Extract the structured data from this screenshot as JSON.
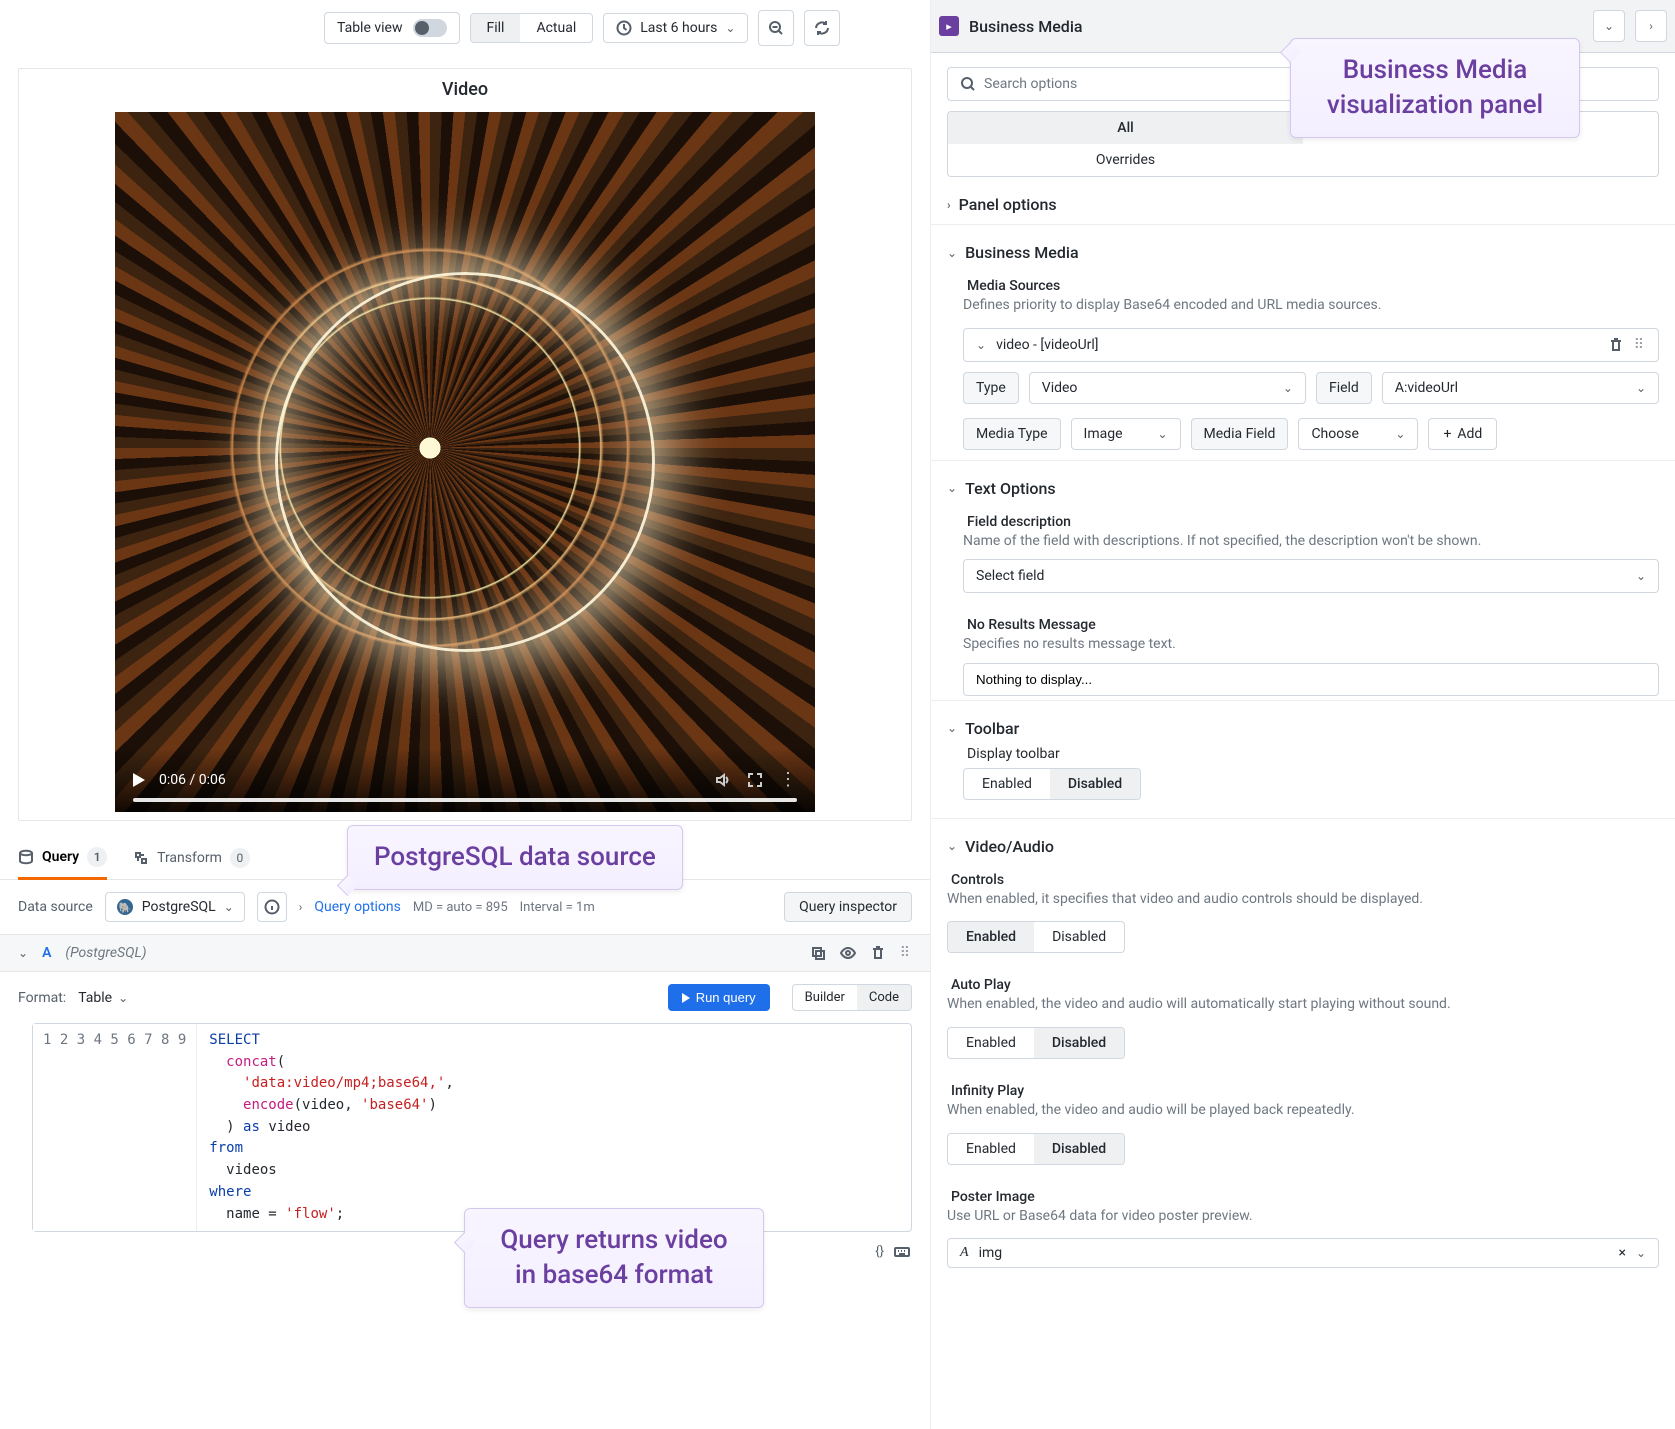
{
  "toolbar": {
    "table_view": "Table view",
    "fill": "Fill",
    "actual": "Actual",
    "time_range": "Last 6 hours"
  },
  "panel": {
    "title": "Video",
    "time_current": "0:06",
    "time_total": "0:06"
  },
  "tabs": {
    "query": "Query",
    "query_badge": "1",
    "transform": "Transform",
    "transform_badge": "0"
  },
  "ds_row": {
    "label": "Data source",
    "selected": "PostgreSQL",
    "query_options": "Query options",
    "md": "MD = auto = 895",
    "interval": "Interval = 1m",
    "inspector": "Query inspector"
  },
  "query": {
    "ref": "A",
    "ds_name": "(PostgreSQL)",
    "format_label": "Format:",
    "format_value": "Table",
    "run": "Run query",
    "builder": "Builder",
    "code": "Code",
    "lines": [
      "1",
      "2",
      "3",
      "4",
      "5",
      "6",
      "7",
      "8",
      "9"
    ],
    "sql": {
      "l1_select": "SELECT",
      "l2_concat": "concat",
      "l3_str": "'data:video/mp4;base64,'",
      "l4_encode": "encode",
      "l4_arg1": "video",
      "l4_str": "'base64'",
      "l5_as": "as",
      "l5_alias": "video",
      "l6_from": "from",
      "l7_table": "videos",
      "l8_where": "where",
      "l9_col": "name",
      "l9_val": "'flow'"
    },
    "footer_brace": "{}"
  },
  "viz": {
    "header_name": "Business Media",
    "search_placeholder": "Search options",
    "tab_all": "All",
    "tab_overrides": "Overrides"
  },
  "sections": {
    "panel_options": "Panel options",
    "business_media": "Business Media",
    "media_sources_title": "Media Sources",
    "media_sources_desc": "Defines priority to display Base64 encoded and URL media sources.",
    "src_item": "video - [videoUrl]",
    "type_label": "Type",
    "type_value": "Video",
    "field_label": "Field",
    "field_value": "A:videoUrl",
    "media_type_label": "Media Type",
    "media_type_value": "Image",
    "media_field_label": "Media Field",
    "media_field_value": "Choose",
    "add_btn": "Add",
    "text_options": "Text Options",
    "field_desc_title": "Field description",
    "field_desc_desc": "Name of the field with descriptions. If not specified, the description won't be shown.",
    "field_desc_select": "Select field",
    "nores_title": "No Results Message",
    "nores_desc": "Specifies no results message text.",
    "nores_value": "Nothing to display...",
    "toolbar_title": "Toolbar",
    "toolbar_sub": "Display toolbar",
    "enabled": "Enabled",
    "disabled": "Disabled",
    "video_audio": "Video/Audio",
    "controls_title": "Controls",
    "controls_desc": "When enabled, it specifies that video and audio controls should be displayed.",
    "autoplay_title": "Auto Play",
    "autoplay_desc": "When enabled, the video and audio will automatically start playing without sound.",
    "infinity_title": "Infinity Play",
    "infinity_desc": "When enabled, the video and audio will be played back repeatedly.",
    "poster_title": "Poster Image",
    "poster_desc": "Use URL or Base64 data for video poster preview.",
    "poster_value": "img"
  },
  "callouts": {
    "c1": "PostgreSQL data source",
    "c2": "Query returns video in base64 format",
    "c3": "Business Media visualization panel"
  }
}
